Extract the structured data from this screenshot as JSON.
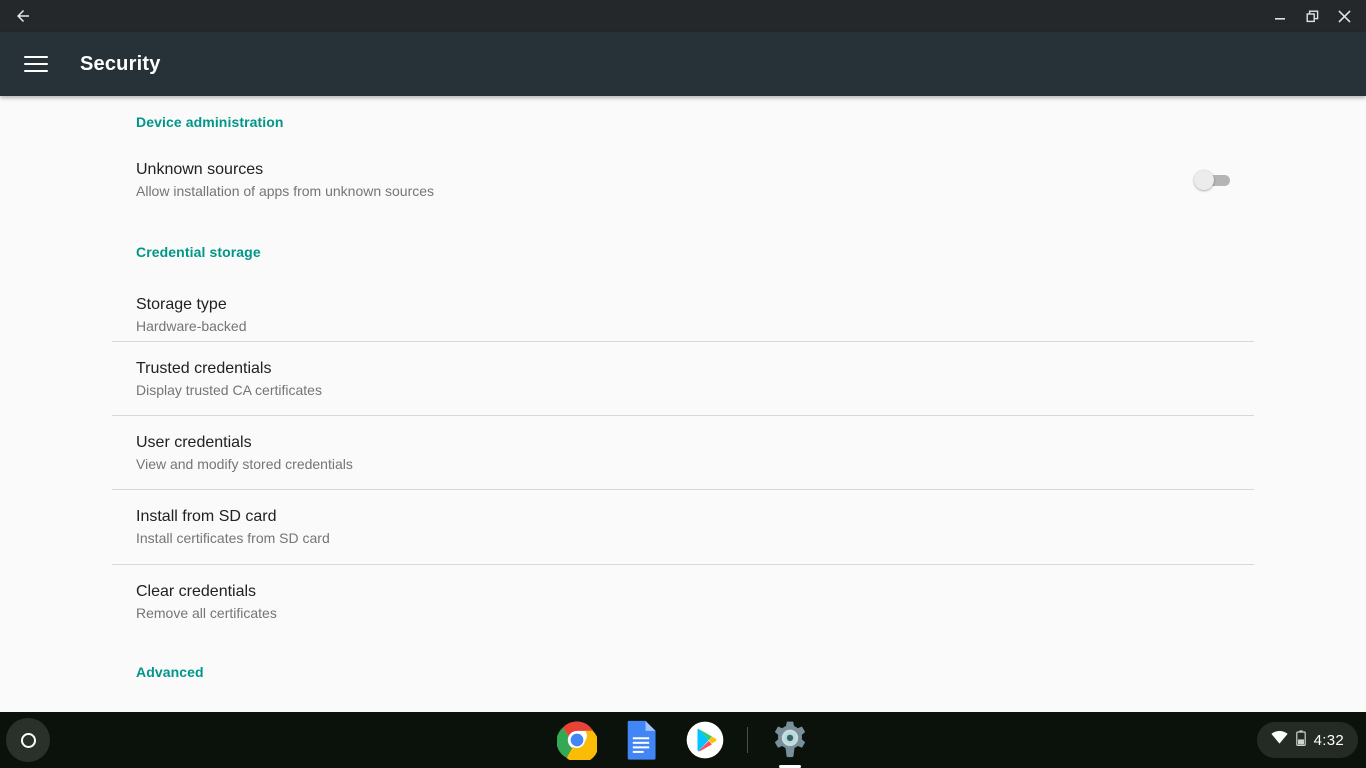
{
  "window": {
    "back_icon": "arrow-back-icon",
    "minimize_icon": "minimize-icon",
    "maximize_icon": "restore-window-icon",
    "close_icon": "close-icon"
  },
  "appbar": {
    "menu_icon": "hamburger-menu-icon",
    "title": "Security"
  },
  "colors": {
    "accent_teal": "#009688",
    "titlebar": "#24282b",
    "appbar": "#263238",
    "content_bg": "#fafafa",
    "shelf": "#0b120b",
    "primary_text": "#212121",
    "secondary_text": "#757575",
    "divider": "#d8d8d8"
  },
  "sections": [
    {
      "header": "Device administration",
      "items": [
        {
          "title": "Unknown sources",
          "summary": "Allow installation of apps from unknown sources",
          "control": "switch",
          "checked": false,
          "divider_after": false
        }
      ]
    },
    {
      "header": "Credential storage",
      "items": [
        {
          "title": "Storage type",
          "summary": "Hardware-backed",
          "control": "none",
          "divider_after": true
        },
        {
          "title": "Trusted credentials",
          "summary": "Display trusted CA certificates",
          "control": "none",
          "divider_after": true
        },
        {
          "title": "User credentials",
          "summary": "View and modify stored credentials",
          "control": "none",
          "divider_after": true
        },
        {
          "title": "Install from SD card",
          "summary": "Install certificates from SD card",
          "control": "none",
          "divider_after": true
        },
        {
          "title": "Clear credentials",
          "summary": "Remove all certificates",
          "control": "none",
          "divider_after": false
        }
      ]
    },
    {
      "header": "Advanced",
      "items": []
    }
  ],
  "shelf": {
    "launcher_icon": "launcher-circle-icon",
    "apps": [
      {
        "name": "chrome",
        "label": "Chrome",
        "active": false
      },
      {
        "name": "docs",
        "label": "Docs",
        "active": false
      },
      {
        "name": "play-store",
        "label": "Play Store",
        "active": false
      },
      {
        "name": "settings",
        "label": "Settings",
        "active": true
      }
    ],
    "status": {
      "wifi_icon": "wifi-icon",
      "battery_icon": "battery-icon",
      "time": "4:32"
    }
  }
}
